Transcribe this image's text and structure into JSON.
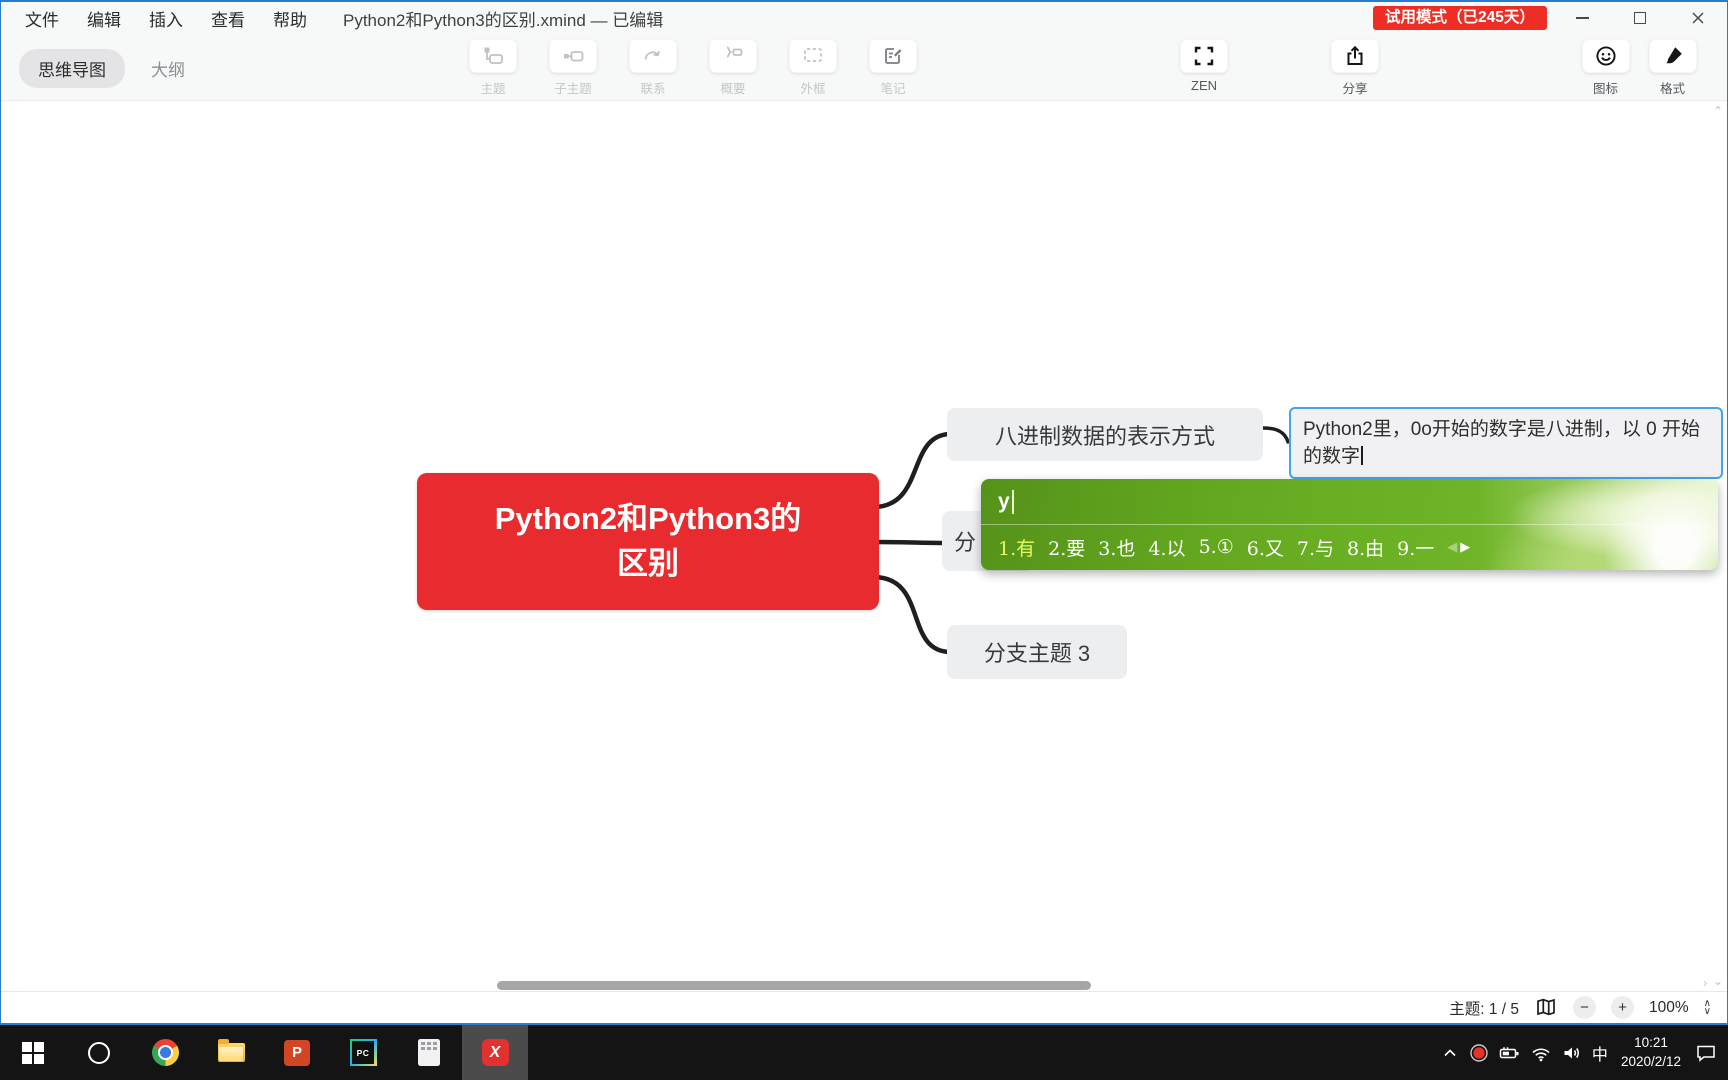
{
  "titlebar": {
    "menus": [
      "文件",
      "编辑",
      "插入",
      "查看",
      "帮助"
    ],
    "document_title": "Python2和Python3的区别.xmind — 已编辑",
    "trial_badge": "试用模式（已245天）"
  },
  "toolbar": {
    "view_tabs": [
      "思维导图",
      "大纲"
    ],
    "tools": [
      "主题",
      "子主题",
      "联系",
      "概要",
      "外框",
      "笔记"
    ],
    "zen": "ZEN",
    "share": "分享",
    "icon": "图标",
    "format": "格式"
  },
  "mindmap": {
    "central_line1": "Python2和Python3的",
    "central_line2": "区别",
    "branch_octal": "八进制数据的表示方式",
    "note_line1": "Python2里，0o开始的数字是八进制，以 0 开始",
    "note_line2": "的数字",
    "branch2_visible": "分",
    "branch3": "分支主题 3"
  },
  "ime": {
    "composition": "y",
    "candidates": [
      "1.有",
      "2.要",
      "3.也",
      "4.以",
      "5.①",
      "6.又",
      "7.与",
      "8.由",
      "9.一"
    ],
    "prev_arrow": "◀",
    "next_arrow": "▶"
  },
  "statusbar": {
    "topic_counter": "主题: 1 / 5",
    "zoom_out": "−",
    "zoom_in": "+",
    "zoom_level": "100%"
  },
  "taskbar": {
    "ime_lang": "中",
    "time": "10:21",
    "date": "2020/2/12",
    "ppt_label": "P",
    "pycharm_label": "PC",
    "xmind_label": "X"
  },
  "colors": {
    "central_topic_red": "#e72b2e",
    "trial_badge_red": "#ee2e24",
    "ime_green": "#65a81f",
    "note_border_blue": "#42a6e8",
    "window_border_blue": "#2b7bd0"
  }
}
